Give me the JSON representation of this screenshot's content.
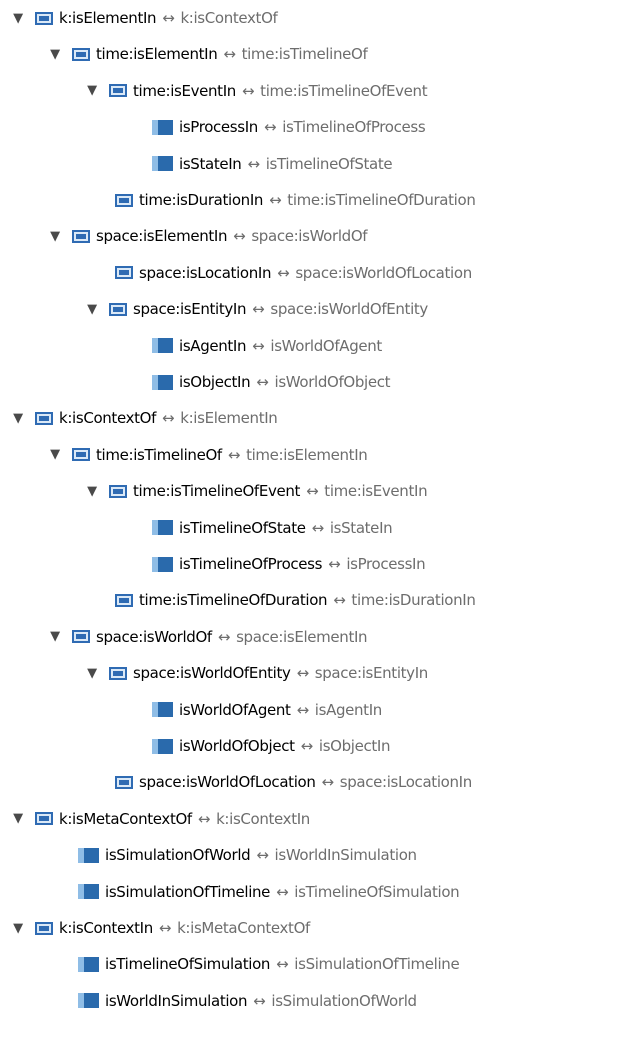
{
  "tree": {
    "toggle_glyph": "▼",
    "arrow_glyph": "↔",
    "rows": [
      {
        "main": "k:isElementIn",
        "inverse": "k:isContextOf",
        "level": 0,
        "expandable": true,
        "icon": "object-property-icon"
      },
      {
        "main": "time:isElementIn",
        "inverse": "time:isTimelineOf",
        "level": 1,
        "expandable": true,
        "icon": "object-property-icon"
      },
      {
        "main": "time:isEventIn",
        "inverse": "time:isTimelineOfEvent",
        "level": 2,
        "expandable": true,
        "icon": "object-property-icon"
      },
      {
        "main": "isProcessIn",
        "inverse": "isTimelineOfProcess",
        "level": 3,
        "expandable": false,
        "icon": "property-filled-icon"
      },
      {
        "main": "isStateIn",
        "inverse": "isTimelineOfState",
        "level": 3,
        "expandable": false,
        "icon": "property-filled-icon"
      },
      {
        "main": "time:isDurationIn",
        "inverse": "time:isTimelineOfDuration",
        "level": 2,
        "expandable": false,
        "icon": "object-property-icon"
      },
      {
        "main": "space:isElementIn",
        "inverse": "space:isWorldOf",
        "level": 1,
        "expandable": true,
        "icon": "object-property-icon"
      },
      {
        "main": "space:isLocationIn",
        "inverse": "space:isWorldOfLocation",
        "level": 2,
        "expandable": false,
        "icon": "object-property-icon"
      },
      {
        "main": "space:isEntityIn",
        "inverse": "space:isWorldOfEntity",
        "level": 2,
        "expandable": true,
        "icon": "object-property-icon"
      },
      {
        "main": "isAgentIn",
        "inverse": "isWorldOfAgent",
        "level": 3,
        "expandable": false,
        "icon": "property-filled-icon"
      },
      {
        "main": "isObjectIn",
        "inverse": "isWorldOfObject",
        "level": 3,
        "expandable": false,
        "icon": "property-filled-icon"
      },
      {
        "main": "k:isContextOf",
        "inverse": "k:isElementIn",
        "level": 0,
        "expandable": true,
        "icon": "object-property-icon"
      },
      {
        "main": "time:isTimelineOf",
        "inverse": "time:isElementIn",
        "level": 1,
        "expandable": true,
        "icon": "object-property-icon"
      },
      {
        "main": "time:isTimelineOfEvent",
        "inverse": "time:isEventIn",
        "level": 2,
        "expandable": true,
        "icon": "object-property-icon"
      },
      {
        "main": "isTimelineOfState",
        "inverse": "isStateIn",
        "level": 3,
        "expandable": false,
        "icon": "property-filled-icon"
      },
      {
        "main": "isTimelineOfProcess",
        "inverse": "isProcessIn",
        "level": 3,
        "expandable": false,
        "icon": "property-filled-icon"
      },
      {
        "main": "time:isTimelineOfDuration",
        "inverse": "time:isDurationIn",
        "level": 2,
        "expandable": false,
        "icon": "object-property-icon"
      },
      {
        "main": "space:isWorldOf",
        "inverse": "space:isElementIn",
        "level": 1,
        "expandable": true,
        "icon": "object-property-icon"
      },
      {
        "main": "space:isWorldOfEntity",
        "inverse": "space:isEntityIn",
        "level": 2,
        "expandable": true,
        "icon": "object-property-icon"
      },
      {
        "main": "isWorldOfAgent",
        "inverse": "isAgentIn",
        "level": 3,
        "expandable": false,
        "icon": "property-filled-icon"
      },
      {
        "main": "isWorldOfObject",
        "inverse": "isObjectIn",
        "level": 3,
        "expandable": false,
        "icon": "property-filled-icon"
      },
      {
        "main": "space:isWorldOfLocation",
        "inverse": "space:isLocationIn",
        "level": 2,
        "expandable": false,
        "icon": "object-property-icon"
      },
      {
        "main": "k:isMetaContextOf",
        "inverse": "k:isContextIn",
        "level": 0,
        "expandable": true,
        "icon": "object-property-icon"
      },
      {
        "main": "isSimulationOfWorld",
        "inverse": "isWorldInSimulation",
        "level": 1,
        "expandable": false,
        "icon": "property-filled-icon"
      },
      {
        "main": "isSimulationOfTimeline",
        "inverse": "isTimelineOfSimulation",
        "level": 1,
        "expandable": false,
        "icon": "property-filled-icon"
      },
      {
        "main": "k:isContextIn",
        "inverse": "k:isMetaContextOf",
        "level": 0,
        "expandable": true,
        "icon": "object-property-icon"
      },
      {
        "main": "isTimelineOfSimulation",
        "inverse": "isSimulationOfTimeline",
        "level": 1,
        "expandable": false,
        "icon": "property-filled-icon"
      },
      {
        "main": "isWorldInSimulation",
        "inverse": "isSimulationOfWorld",
        "level": 1,
        "expandable": false,
        "icon": "property-filled-icon"
      }
    ]
  }
}
